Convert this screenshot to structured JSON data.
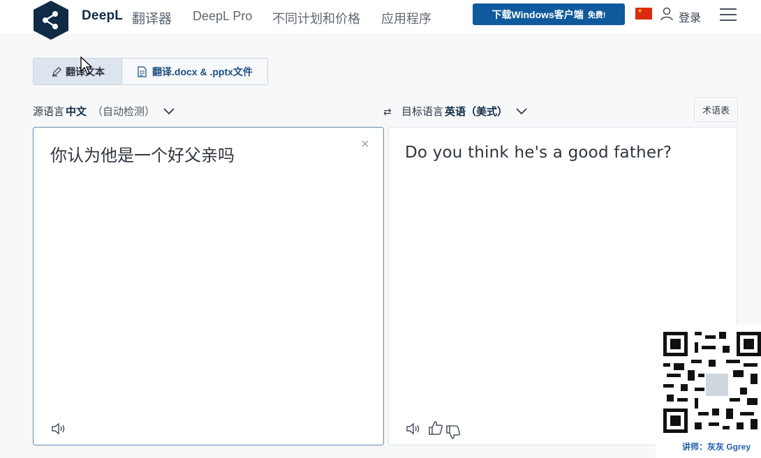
{
  "header": {
    "brand": "DeepL",
    "brand_sub": "翻译器",
    "nav": [
      "DeepL Pro",
      "不同计划和价格",
      "应用程序"
    ],
    "download_button": "下载Windows客户端",
    "download_badge": "免费!",
    "login": "登录",
    "logo_icon": "deepl-logo-icon",
    "flag_icon": "china-flag-icon",
    "user_icon": "user-icon",
    "menu_icon": "hamburger-menu-icon"
  },
  "tabs": {
    "text_tab": "翻译文本",
    "doc_tab": "翻译.docx & .pptx文件"
  },
  "source_language": {
    "prefix": "源语言",
    "language": "中文",
    "detect": "（自动检测）"
  },
  "target_language": {
    "prefix": "目标语言",
    "language": "英语（美式）"
  },
  "glossary_button": "术语表",
  "source_text": "你认为他是一个好父亲吗",
  "translated_text": "Do you think he's a good father?",
  "overlay": {
    "teacher": "讲师：灰灰 Ggrey"
  },
  "colors": {
    "accent": "#0f5a9c",
    "brand_dark": "#0f2b46",
    "active_border": "#5f8bb4"
  }
}
